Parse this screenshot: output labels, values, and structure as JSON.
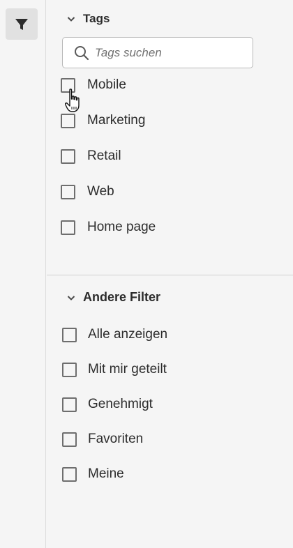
{
  "rail": {
    "filter_button_icon": "filter-icon"
  },
  "tags_section": {
    "title": "Tags",
    "search_placeholder": "Tags suchen",
    "items": [
      {
        "label": "Mobile",
        "checked": false
      },
      {
        "label": "Marketing",
        "checked": false
      },
      {
        "label": "Retail",
        "checked": false
      },
      {
        "label": "Web",
        "checked": false
      },
      {
        "label": "Home page",
        "checked": false
      }
    ]
  },
  "other_filters_section": {
    "title": "Andere Filter",
    "items": [
      {
        "label": "Alle anzeigen",
        "checked": false
      },
      {
        "label": "Mit mir geteilt",
        "checked": false
      },
      {
        "label": "Genehmigt",
        "checked": false
      },
      {
        "label": "Favoriten",
        "checked": false
      },
      {
        "label": "Meine",
        "checked": false
      }
    ]
  },
  "colors": {
    "background": "#f5f5f5",
    "checkbox_border": "#6e6e6e",
    "text": "#2c2c2c"
  }
}
